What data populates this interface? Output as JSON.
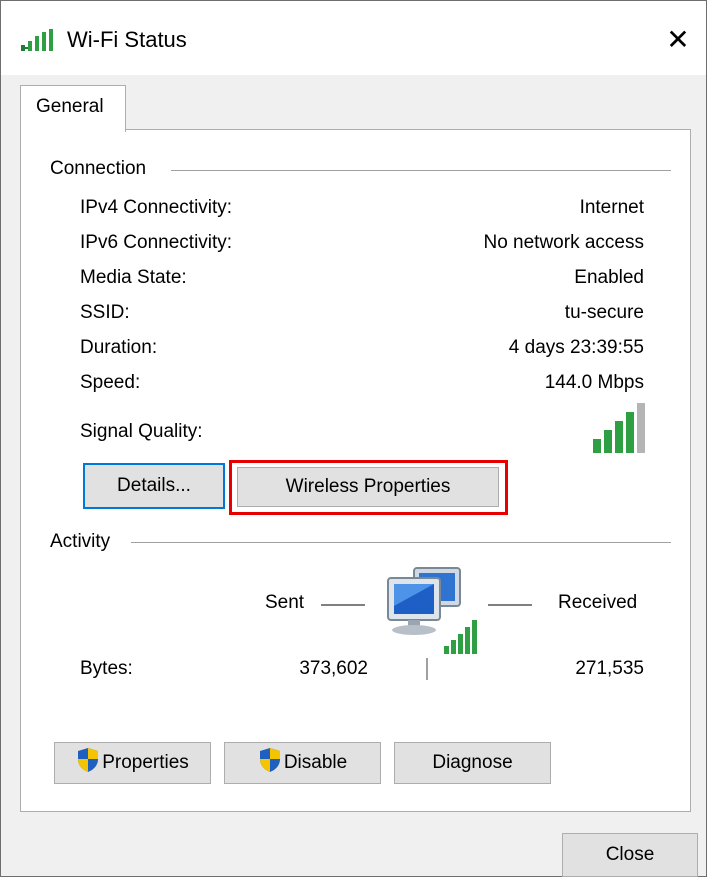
{
  "window": {
    "title": "Wi-Fi Status",
    "close_glyph": "✕"
  },
  "tabs": [
    {
      "label": "General"
    }
  ],
  "connection": {
    "group_label": "Connection",
    "rows": [
      {
        "label": "IPv4 Connectivity:",
        "value": "Internet"
      },
      {
        "label": "IPv6 Connectivity:",
        "value": "No network access"
      },
      {
        "label": "Media State:",
        "value": "Enabled"
      },
      {
        "label": "SSID:",
        "value": "tu-secure"
      },
      {
        "label": "Duration:",
        "value": "4 days 23:39:55"
      },
      {
        "label": "Speed:",
        "value": "144.0 Mbps"
      }
    ],
    "signal_quality_label": "Signal Quality:",
    "signal_quality_bars": 4,
    "signal_quality_max_bars": 5,
    "details_button": "Details...",
    "wireless_properties_button": "Wireless Properties"
  },
  "activity": {
    "group_label": "Activity",
    "sent_label": "Sent",
    "received_label": "Received",
    "bytes_label": "Bytes:",
    "bytes_sent": "373,602",
    "bytes_received": "271,535"
  },
  "buttons": {
    "properties": "Properties",
    "disable": "Disable",
    "diagnose": "Diagnose",
    "close": "Close"
  },
  "colors": {
    "signal_green": "#2ea043",
    "focus_blue": "#0078d7",
    "highlight_red": "#e60000",
    "shield_blue": "#1f5fbf",
    "shield_yellow": "#f5c400"
  }
}
